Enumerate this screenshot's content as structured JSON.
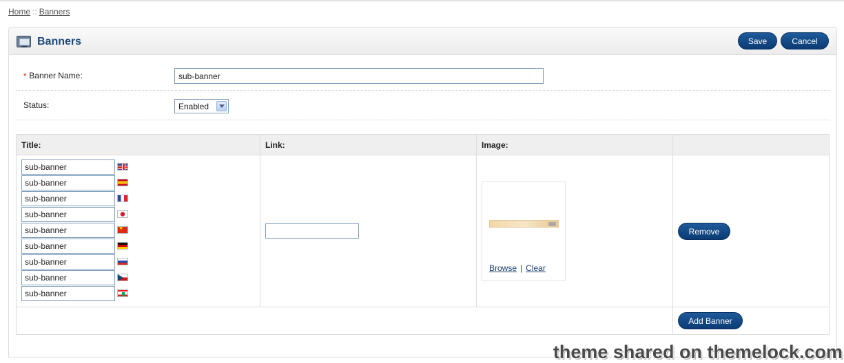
{
  "breadcrumb": {
    "home": "Home",
    "separator": "::",
    "current": "Banners"
  },
  "panel": {
    "title": "Banners",
    "icon": "banner-icon"
  },
  "buttons": {
    "save": "Save",
    "cancel": "Cancel",
    "remove": "Remove",
    "add_banner": "Add Banner"
  },
  "form": {
    "banner_name": {
      "required_mark": "*",
      "label": "Banner Name:",
      "value": "sub-banner"
    },
    "status": {
      "label": "Status:",
      "value": "Enabled"
    }
  },
  "table": {
    "headers": {
      "title": "Title:",
      "link": "Link:",
      "image": "Image:",
      "action": ""
    },
    "titles": [
      {
        "value": "sub-banner",
        "flag": "gb"
      },
      {
        "value": "sub-banner",
        "flag": "es"
      },
      {
        "value": "sub-banner",
        "flag": "fr"
      },
      {
        "value": "sub-banner",
        "flag": "jp"
      },
      {
        "value": "sub-banner",
        "flag": "cn"
      },
      {
        "value": "sub-banner",
        "flag": "de"
      },
      {
        "value": "sub-banner",
        "flag": "ru"
      },
      {
        "value": "sub-banner",
        "flag": "cz"
      },
      {
        "value": "sub-banner",
        "flag": "lb"
      }
    ],
    "link_value": "",
    "image_links": {
      "browse": "Browse",
      "separator": "|",
      "clear": "Clear"
    }
  },
  "watermark": "theme shared on themelock.com",
  "colors": {
    "accent_button": "#0b3b74",
    "title": "#1c4a7c",
    "required": "#ee0000"
  }
}
